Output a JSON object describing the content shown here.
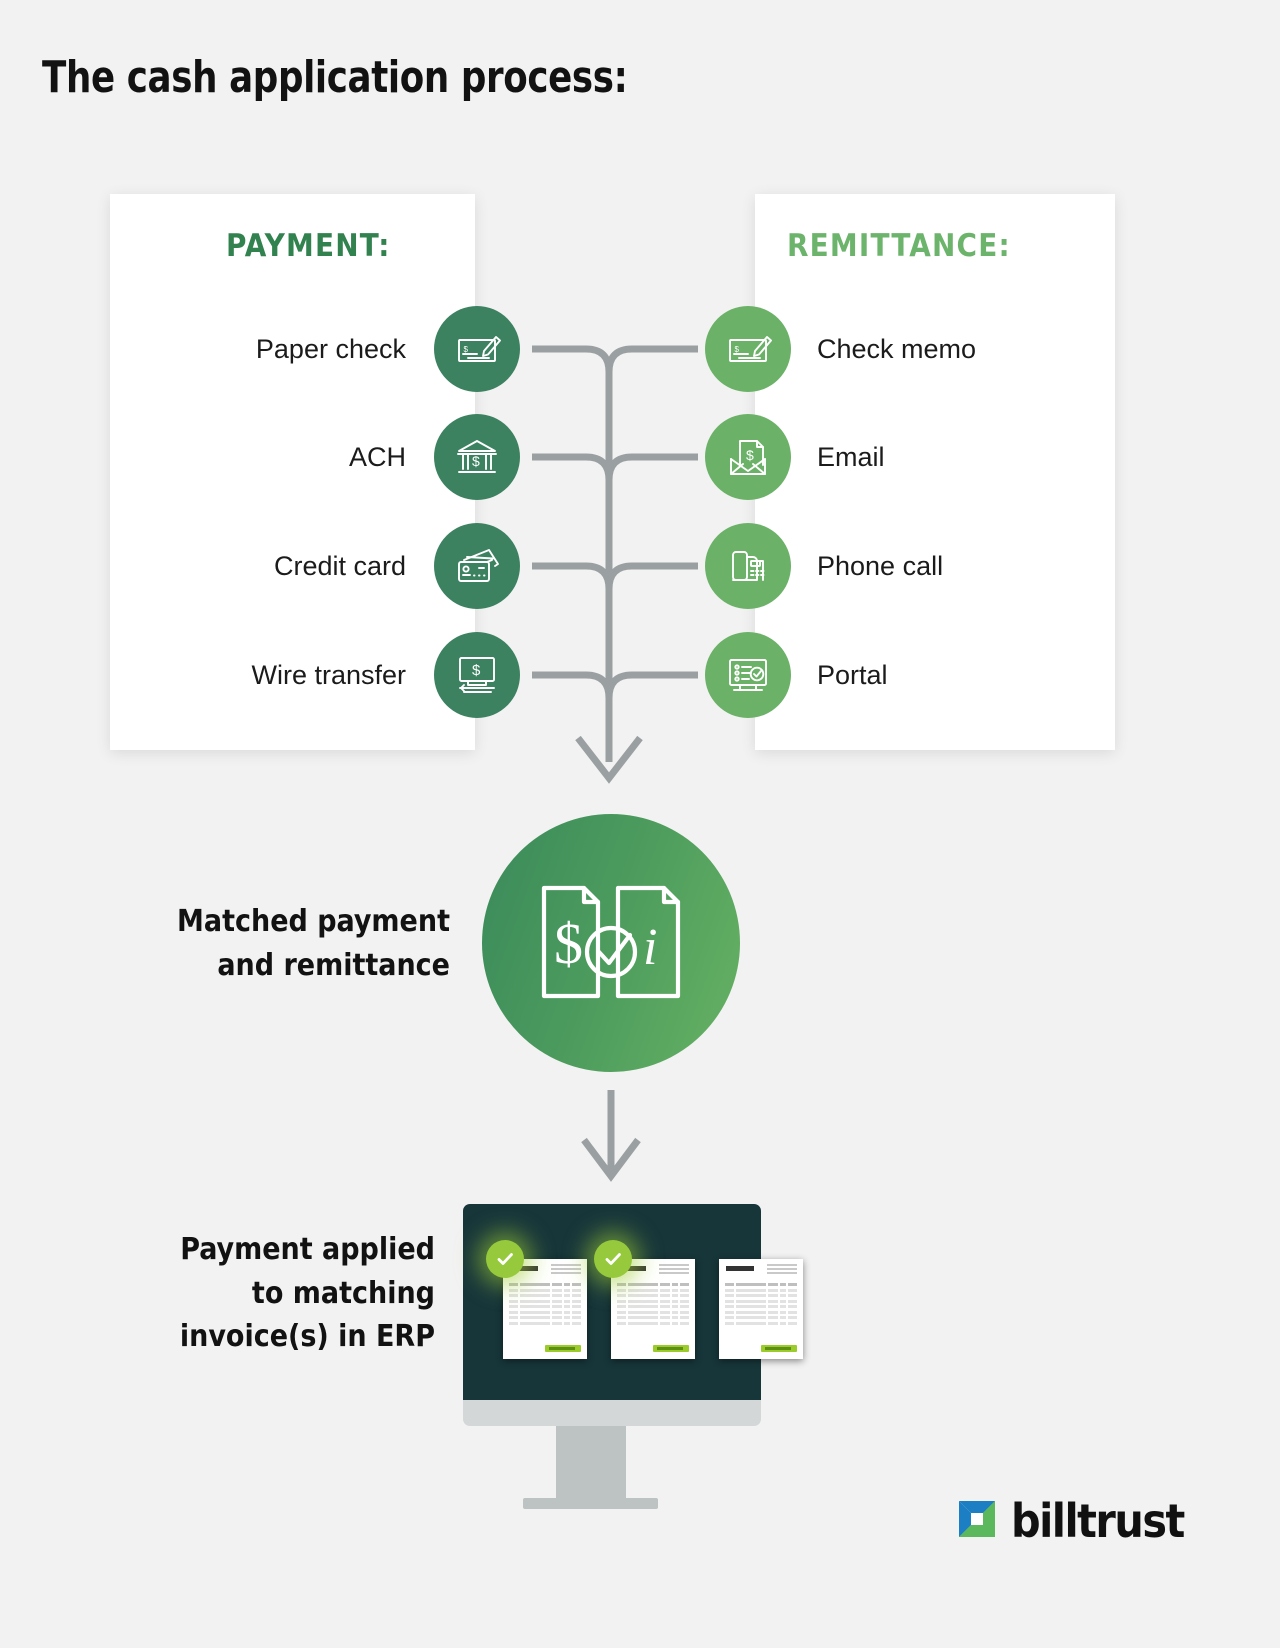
{
  "title": "The cash application process:",
  "columns": {
    "payment": {
      "header": "PAYMENT:",
      "header_color": "#31824f"
    },
    "remittance": {
      "header": "REMITTANCE:",
      "header_color": "#6cb36b"
    }
  },
  "payment_methods": [
    {
      "label": "Paper check",
      "icon": "check-pencil-icon"
    },
    {
      "label": "ACH",
      "icon": "bank-dollar-icon"
    },
    {
      "label": "Credit card",
      "icon": "credit-cards-icon"
    },
    {
      "label": "Wire transfer",
      "icon": "monitor-dollar-transfer-icon"
    }
  ],
  "remittance_methods": [
    {
      "label": "Check memo",
      "icon": "check-pencil-icon"
    },
    {
      "label": "Email",
      "icon": "envelope-dollar-document-icon"
    },
    {
      "label": "Phone call",
      "icon": "desk-phone-icon"
    },
    {
      "label": "Portal",
      "icon": "monitor-checklist-icon"
    }
  ],
  "steps": {
    "matched": {
      "label_line1": "Matched payment",
      "label_line2": "and remittance",
      "icon": "matched-documents-check-icon"
    },
    "applied": {
      "label_line1": "Payment applied",
      "label_line2": "to matching",
      "label_line3": "invoice(s) in ERP",
      "icon": "erp-monitor-invoices-icon"
    }
  },
  "logo": {
    "text": "billtrust",
    "mark": "billtrust-cube-icon"
  },
  "colors": {
    "background": "#f2f2f2",
    "panel": "#ffffff",
    "dark_green": "#3c8260",
    "light_green": "#6bb268",
    "connector_gray": "#9aa0a2",
    "monitor_dark": "#17363a",
    "lime": "#97c93d"
  }
}
